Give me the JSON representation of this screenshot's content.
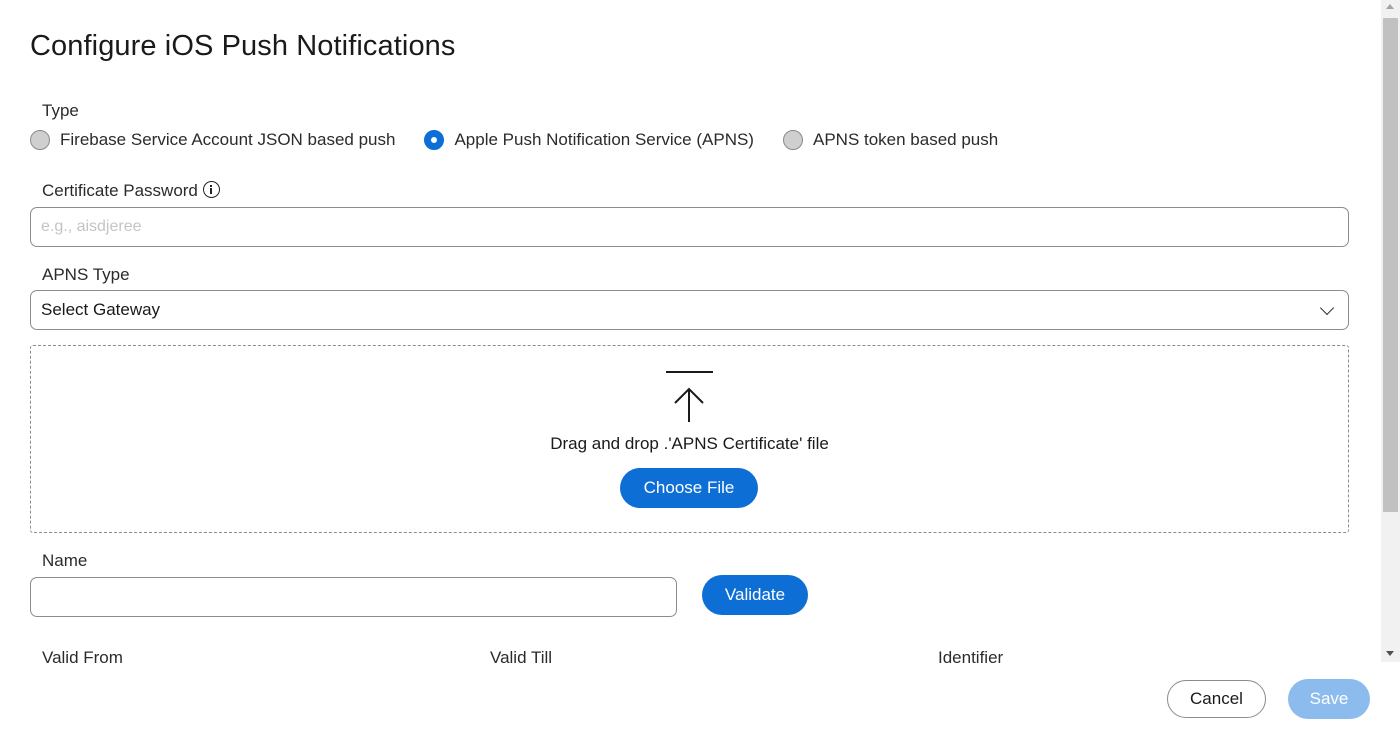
{
  "dialog": {
    "title": "Configure iOS Push Notifications"
  },
  "type_section": {
    "label": "Type",
    "options": [
      {
        "label": "Firebase Service Account JSON based push",
        "checked": false
      },
      {
        "label": "Apple Push Notification Service (APNS)",
        "checked": true
      },
      {
        "label": "APNS token based push",
        "checked": false
      }
    ]
  },
  "certificate_password": {
    "label": "Certificate Password",
    "placeholder": "e.g., aisdjeree",
    "value": "",
    "icon": "info-icon"
  },
  "apns_type": {
    "label": "APNS Type",
    "selected": "Select Gateway",
    "icon": "chevron-down-icon"
  },
  "upload": {
    "icon": "upload-icon",
    "text": "Drag and drop .'APNS Certificate' file",
    "button_label": "Choose File"
  },
  "name": {
    "label": "Name",
    "value": "",
    "validate_label": "Validate"
  },
  "validity": {
    "columns": [
      "Valid From",
      "Valid Till",
      "Identifier"
    ]
  },
  "footer": {
    "cancel_label": "Cancel",
    "save_label": "Save"
  },
  "colors": {
    "primary": "#0d6ed6",
    "primary_disabled": "#8cbbee",
    "border": "#8c8c8c"
  }
}
